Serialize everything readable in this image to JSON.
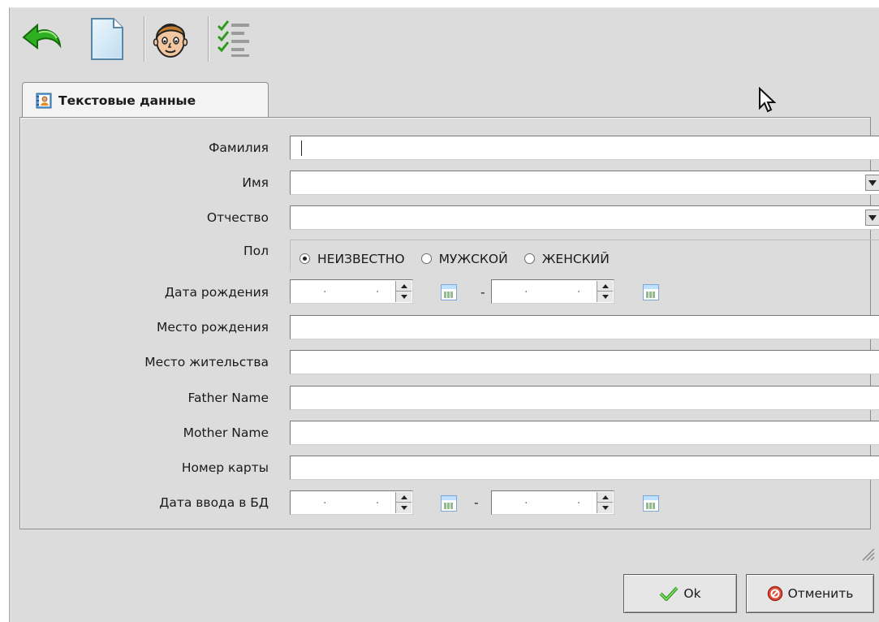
{
  "toolbar": {
    "buttons": [
      {
        "name": "back",
        "icon": "back-arrow-icon"
      },
      {
        "name": "new",
        "icon": "new-document-icon"
      },
      {
        "name": "person",
        "icon": "person-face-icon"
      },
      {
        "name": "checklist",
        "icon": "checklist-icon"
      }
    ]
  },
  "tab": {
    "label": "Текстовые данные",
    "icon": "address-book-icon"
  },
  "form": {
    "last_name_label": "Фамилия",
    "first_name_label": "Имя",
    "patronymic_label": "Отчество",
    "gender_label": "Пол",
    "gender_options": [
      "НЕИЗВЕСТНО",
      "МУЖСКОЙ",
      "ЖЕНСКИЙ"
    ],
    "gender_selected": "НЕИЗВЕСТНО",
    "birth_date_label": "Дата рождения",
    "birth_place_label": "Место рождения",
    "residence_label": "Место жительства",
    "father_label": "Father Name",
    "mother_label": "Mother Name",
    "card_label": "Номер карты",
    "entry_date_label": "Дата ввода в БД",
    "range_separator": "-",
    "date_placeholder": ". ."
  },
  "buttons": {
    "ok": "Ok",
    "cancel": "Отменить"
  },
  "colors": {
    "accent_green": "#2e9b1e",
    "cancel_red": "#d83a2a"
  }
}
